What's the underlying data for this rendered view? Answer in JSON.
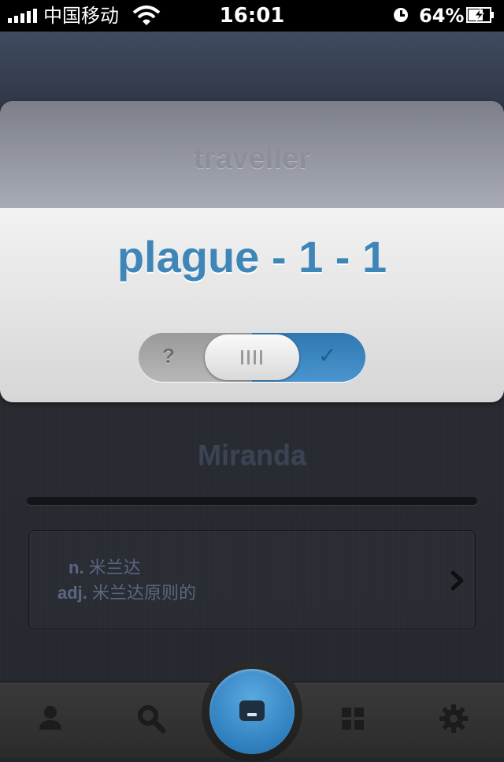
{
  "status_bar": {
    "carrier": "中国移动",
    "time": "16:01",
    "battery_percent": "64%"
  },
  "card": {
    "previous_word": "traveller",
    "current_word": "plague - 1 - 1",
    "slider": {
      "left_label": "?",
      "right_label": "✓"
    }
  },
  "detail": {
    "headword": "Miranda",
    "definitions": [
      {
        "pos": "n.",
        "text": " 米兰达"
      },
      {
        "pos": "adj.",
        "text": " 米兰达原则的"
      }
    ]
  },
  "tab_bar": {
    "items": [
      "person-icon",
      "search-icon",
      "card-icon",
      "grid-icon",
      "gear-icon"
    ]
  },
  "colors": {
    "accent_blue": "#3f86b8",
    "headword": "#3b4354",
    "definition_text": "#5a6782"
  }
}
